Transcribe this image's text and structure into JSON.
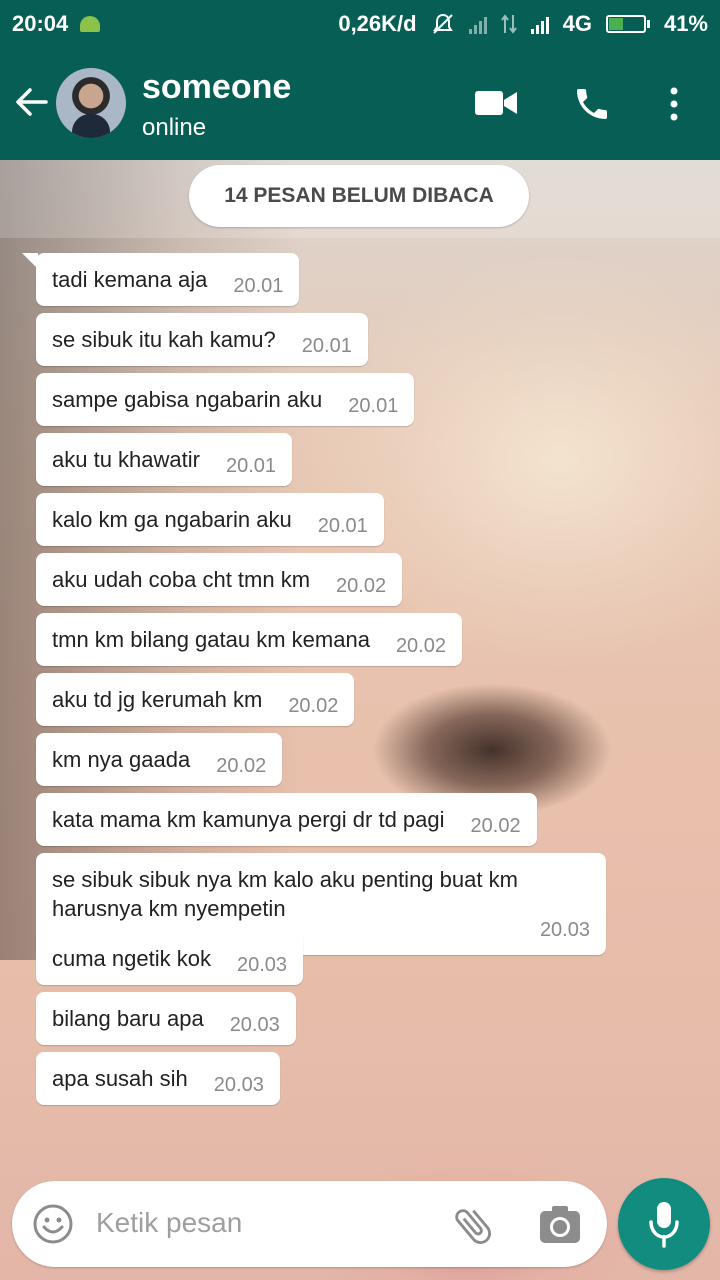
{
  "status_bar": {
    "time": "20:04",
    "net_speed": "0,26K/d",
    "network": "4G",
    "battery_percent": "41%",
    "battery_level": 0.41
  },
  "header": {
    "contact_name": "someone",
    "contact_status": "online",
    "icons": [
      "back-arrow-icon",
      "video-call-icon",
      "phone-icon",
      "more-vert-icon"
    ]
  },
  "unread_banner": "14 PESAN BELUM DIBACA",
  "messages": [
    {
      "text": "tadi kemana aja",
      "time": "20.01"
    },
    {
      "text": "se sibuk itu kah kamu?",
      "time": "20.01"
    },
    {
      "text": "sampe gabisa ngabarin aku",
      "time": "20.01"
    },
    {
      "text": "aku tu khawatir",
      "time": "20.01"
    },
    {
      "text": "kalo km ga ngabarin aku",
      "time": "20.01"
    },
    {
      "text": "aku udah coba cht tmn km",
      "time": "20.02"
    },
    {
      "text": "tmn km bilang gatau km kemana",
      "time": "20.02"
    },
    {
      "text": "aku td jg kerumah km",
      "time": "20.02"
    },
    {
      "text": "km nya gaada",
      "time": "20.02"
    },
    {
      "text": "kata mama km kamunya pergi dr td pagi",
      "time": "20.02"
    },
    {
      "text": "se sibuk sibuk nya km kalo aku penting buat km harusnya km nyempetin",
      "time": "20.03"
    },
    {
      "text": "cuma ngetik kok",
      "time": "20.03"
    },
    {
      "text": "bilang baru apa",
      "time": "20.03"
    },
    {
      "text": "apa susah sih",
      "time": "20.03"
    }
  ],
  "composer": {
    "placeholder": "Ketik pesan",
    "icons": [
      "emoji-icon",
      "attach-icon",
      "camera-icon",
      "mic-icon"
    ]
  }
}
